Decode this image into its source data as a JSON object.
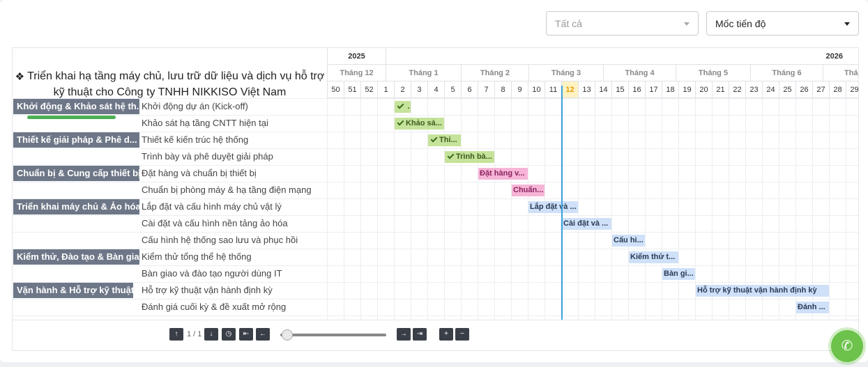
{
  "filters": {
    "all": {
      "value": "Tất cả"
    },
    "milestone": {
      "value": "Mốc tiến độ"
    }
  },
  "project": {
    "title": "Triển khai hạ tầng máy chủ, lưu trữ dữ liệu và dịch vụ hỗ trợ kỹ thuật cho Công ty TNHH NIKKISO Việt Nam",
    "icon": "cubes-icon"
  },
  "timeline": {
    "years": [
      "2025",
      "2026"
    ],
    "months": [
      "Tháng 12",
      "Tháng 1",
      "Tháng 2",
      "Tháng 3",
      "Tháng 4",
      "Tháng 5",
      "Tháng 6",
      "Thá"
    ],
    "weeks": [
      "50",
      "51",
      "52",
      "1",
      "2",
      "3",
      "4",
      "5",
      "6",
      "7",
      "8",
      "9",
      "10",
      "11",
      "12",
      "13",
      "14",
      "15",
      "16",
      "17",
      "18",
      "19",
      "20",
      "21",
      "22",
      "23",
      "24",
      "25",
      "26",
      "27",
      "28",
      "29"
    ],
    "current_week": "12"
  },
  "groups": [
    {
      "label": "Khởi động & Khảo sát hệ th...",
      "progress": 0.7
    },
    {
      "label": "Thiết kế giải pháp & Phê d..."
    },
    {
      "label": "Chuẩn bị & Cung cấp thiết bị"
    },
    {
      "label": "Triển khai máy chủ & Ảo hóa"
    },
    {
      "label": "Kiểm thử, Đào tạo & Bàn giao"
    },
    {
      "label": "Vận hành & Hỗ trợ kỹ thuật"
    }
  ],
  "tasks": [
    {
      "name": "Khởi động dự án (Kick-off)",
      "bar": "...",
      "color": "#c5e39a",
      "done": true
    },
    {
      "name": "Khảo sát hạ tầng CNTT hiện tại",
      "bar": "Khảo sá...",
      "color": "#c5e39a",
      "done": true
    },
    {
      "name": "Thiết kế kiến trúc hệ thống",
      "bar": "Thi...",
      "color": "#c5e39a",
      "done": true
    },
    {
      "name": "Trình bày và phê duyệt giải pháp",
      "bar": "Trình bà...",
      "color": "#c5e39a",
      "done": true
    },
    {
      "name": "Đặt hàng và chuẩn bị thiết bị",
      "bar": "Đặt hàng v...",
      "color": "#f6b5d7"
    },
    {
      "name": "Chuẩn bị phòng máy & hạ tầng điện mạng",
      "bar": "Chuẩn...",
      "color": "#f6b5d7"
    },
    {
      "name": "Lắp đặt và cấu hình máy chủ vật lý",
      "bar": "Lắp đặt và ...",
      "color": "#cfe1f8"
    },
    {
      "name": "Cài đặt và cấu hình nền tảng ảo hóa",
      "bar": "Cài đặt và ...",
      "color": "#cfe1f8"
    },
    {
      "name": "Cấu hình hệ thống sao lưu và phục hồi",
      "bar": "Cấu hi...",
      "color": "#cfe1f8"
    },
    {
      "name": "Kiểm thử tổng thể hệ thống",
      "bar": "Kiểm thử t...",
      "color": "#cfe1f8"
    },
    {
      "name": "Bàn giao và đào tạo người dùng IT",
      "bar": "Bàn gi...",
      "color": "#cfe1f8"
    },
    {
      "name": "Hỗ trợ kỹ thuật vận hành định kỳ",
      "bar": "Hỗ trợ kỹ thuật vận hành định kỳ",
      "color": "#cfe1f8"
    },
    {
      "name": "Đánh giá cuối kỳ & đề xuất mở rộng",
      "bar": "Đánh ...",
      "color": "#cfe1f8"
    }
  ],
  "controls": {
    "pager": "1 / 1",
    "icons": [
      "arrow-up-icon",
      "arrow-down-icon",
      "clock-icon",
      "skip-back-icon",
      "arrow-left-icon",
      "arrow-right-icon",
      "skip-forward-icon",
      "zoom-in-icon",
      "zoom-out-icon"
    ],
    "zoom_level": 0.05
  },
  "call": {
    "icon": "phone-icon",
    "color": "#6cc24a"
  }
}
